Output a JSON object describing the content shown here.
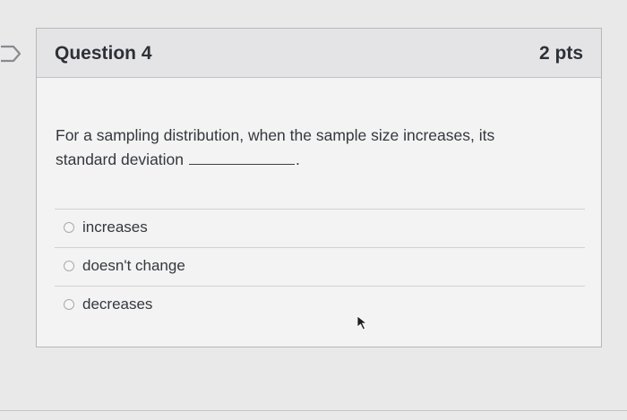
{
  "question": {
    "title": "Question 4",
    "points": "2 pts",
    "text_before_blank": "For a sampling distribution, when the sample size increases, its standard deviation",
    "text_after_blank": "."
  },
  "answers": [
    {
      "label": "increases"
    },
    {
      "label": "doesn't change"
    },
    {
      "label": "decreases"
    }
  ],
  "icons": {
    "flag": "flag-icon",
    "radio": "radio-circle-icon",
    "cursor": "mouse-pointer-icon"
  },
  "colors": {
    "background": "#e9e9ea",
    "header_background": "#e4e4e6",
    "text": "#2d3136",
    "border": "#b8b8bb"
  }
}
